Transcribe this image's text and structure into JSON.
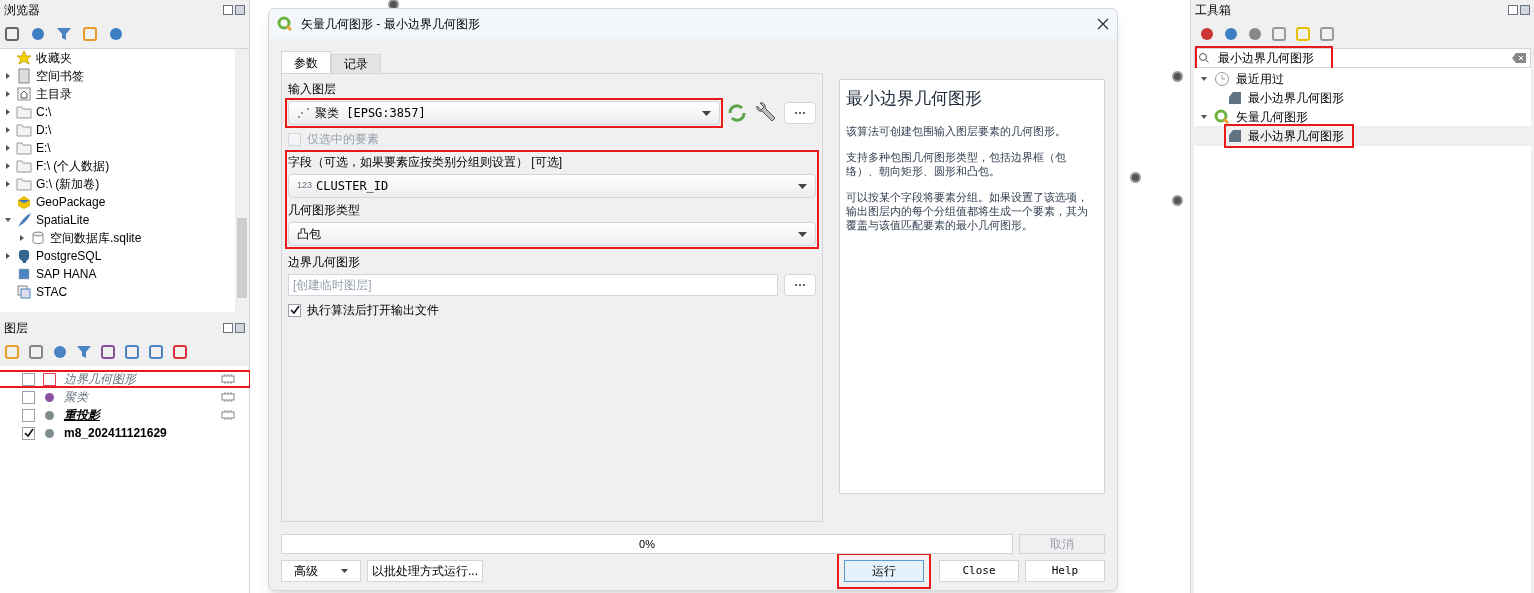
{
  "browser": {
    "title": "浏览器",
    "items": [
      {
        "label": "收藏夹",
        "kind": "favorites"
      },
      {
        "label": "空间书签",
        "kind": "bookmarks",
        "expanded": false
      },
      {
        "label": "主目录",
        "kind": "home",
        "expanded": false
      },
      {
        "label": "C:\\",
        "kind": "folder",
        "expanded": false
      },
      {
        "label": "D:\\",
        "kind": "folder",
        "expanded": false
      },
      {
        "label": "E:\\",
        "kind": "folder",
        "expanded": false
      },
      {
        "label": "F:\\ (个人数据)",
        "kind": "folder",
        "expanded": false
      },
      {
        "label": "G:\\ (新加卷)",
        "kind": "folder",
        "expanded": false
      },
      {
        "label": "GeoPackage",
        "kind": "geopackage"
      },
      {
        "label": "SpatiaLite",
        "kind": "spatialite",
        "expanded": true,
        "children": [
          {
            "label": "空间数据库.sqlite",
            "kind": "sqlite",
            "expanded": false
          }
        ]
      },
      {
        "label": "PostgreSQL",
        "kind": "postgres",
        "expanded": false
      },
      {
        "label": "SAP HANA",
        "kind": "hana"
      },
      {
        "label": "STAC",
        "kind": "stac"
      }
    ]
  },
  "layers": {
    "title": "图层",
    "items": [
      {
        "name": "边界几何图形",
        "checked": false,
        "bold": false,
        "kind": "polygon",
        "color": "#e0435a",
        "indicator": true,
        "highlighted": true
      },
      {
        "name": "聚类",
        "checked": false,
        "bold": false,
        "kind": "point",
        "color": "#8a4f9e",
        "indicator": true,
        "highlighted": false
      },
      {
        "name": "重投影",
        "checked": false,
        "bold": true,
        "kind": "point",
        "color": "#7f8c8d",
        "indicator": true,
        "highlighted": false
      },
      {
        "name": "m8_202411121629",
        "checked": true,
        "bold": true,
        "kind": "point",
        "color": "#7f8c8d",
        "indicator": false,
        "highlighted": false
      }
    ]
  },
  "dialog": {
    "title": "矢量几何图形 - 最小边界几何图形",
    "tabs": [
      {
        "label": "参数",
        "selected": true
      },
      {
        "label": "记录",
        "selected": false
      }
    ],
    "input_layer": {
      "label": "输入图层",
      "value": "聚类 [EPSG:3857]",
      "highlighted": true
    },
    "selected_only": {
      "label": "仅选中的要素",
      "checked": false,
      "disabled": true
    },
    "group": {
      "highlighted": true,
      "field": {
        "label": "字段（可选，如果要素应按类别分组则设置） [可选]",
        "prefix": "123",
        "value": "CLUSTER_ID"
      },
      "geometry_type": {
        "label": "几何图形类型",
        "value": "凸包"
      }
    },
    "output": {
      "label": "边界几何图形",
      "placeholder": "[创建临时图层]"
    },
    "open_output": {
      "label": "执行算法后打开输出文件",
      "checked": true
    },
    "help": {
      "title": "最小边界几何图形",
      "paragraphs": [
        "该算法可创建包围输入图层要素的几何图形。",
        "支持多种包围几何图形类型，包括边界框（包络）、朝向矩形、圆形和凸包。",
        "可以按某个字段将要素分组。如果设置了该选项，输出图层内的每个分组值都将生成一个要素，其为覆盖与该值匹配要素的最小几何图形。"
      ]
    },
    "progress": {
      "text": "0%",
      "level": 0
    },
    "cancel": {
      "label": "取消",
      "disabled": true
    },
    "advanced": "高级",
    "batch": "以批处理方式运行...",
    "buttons": [
      {
        "label": "运行",
        "highlighted": true
      },
      {
        "label": "Close",
        "highlighted": false
      },
      {
        "label": "Help",
        "highlighted": false
      }
    ]
  },
  "toolbox": {
    "title": "工具箱",
    "search": {
      "value": "最小边界几何图形",
      "highlighted": true
    },
    "tree": [
      {
        "label": "最近用过",
        "kind": "recent",
        "expanded": true,
        "children": [
          {
            "label": "最小边界几何图形",
            "selected": false,
            "highlighted": false
          }
        ]
      },
      {
        "label": "矢量几何图形",
        "kind": "qgis",
        "expanded": true,
        "children": [
          {
            "label": "最小边界几何图形",
            "selected": true,
            "highlighted": true
          }
        ]
      }
    ]
  }
}
